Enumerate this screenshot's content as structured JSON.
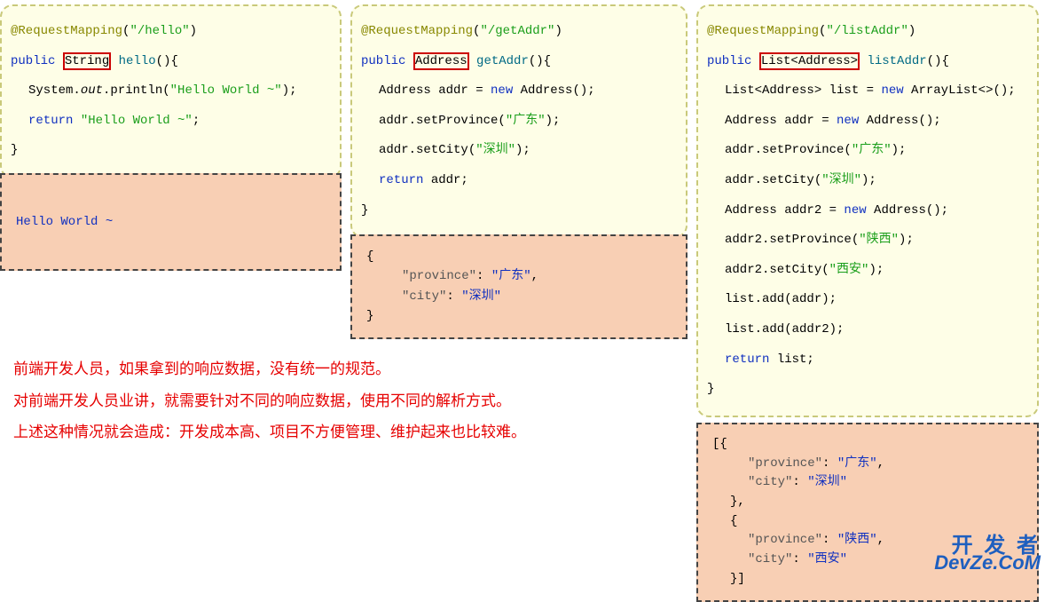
{
  "col1": {
    "anno": "@RequestMapping",
    "path": "\"/hello\"",
    "pub": "public",
    "type": "String",
    "method": "hello",
    "sys_pre": "System.",
    "sys_out": "out",
    "sys_post": ".println(",
    "sys_str": "\"Hello World ~\"",
    "ret": "return ",
    "ret_str": "\"Hello World ~\"",
    "output": "Hello World ~"
  },
  "col2": {
    "anno": "@RequestMapping",
    "path": "\"/getAddr\"",
    "pub": "public",
    "type": "Address",
    "method": "getAddr",
    "l1_pre": "Address addr = ",
    "l1_new": "new",
    "l1_post": " Address();",
    "l2_pre": "addr.setProvince(",
    "l2_str": "\"广东\"",
    "l3_pre": "addr.setCity(",
    "l3_str": "\"深圳\"",
    "ret": "return ",
    "ret_obj": "addr;",
    "out_k1": "\"province\"",
    "out_v1": "\"广东\"",
    "out_k2": "\"city\"",
    "out_v2": "\"深圳\""
  },
  "col3": {
    "anno": "@RequestMapping",
    "path": "\"/listAddr\"",
    "pub": "public",
    "type": "List<Address>",
    "method": "listAddr",
    "l1_pre": "List<Address> list = ",
    "l1_new": "new",
    "l1_post": " ArrayList<>();",
    "l2_pre": "Address addr = ",
    "l2_new": "new",
    "l2_post": " Address();",
    "l3_pre": "addr.setProvince(",
    "l3_str": "\"广东\"",
    "l4_pre": "addr.setCity(",
    "l4_str": "\"深圳\"",
    "l5_pre": "Address addr2 = ",
    "l5_new": "new",
    "l5_post": " Address();",
    "l6_pre": "addr2.setProvince(",
    "l6_str": "\"陕西\"",
    "l7_pre": "addr2.setCity(",
    "l7_str": "\"西安\"",
    "l8": "list.add(addr);",
    "l9": "list.add(addr2);",
    "ret": "return ",
    "ret_obj": "list;",
    "out_k1": "\"province\"",
    "out_v1": "\"广东\"",
    "out_k2": "\"city\"",
    "out_v2": "\"深圳\"",
    "out_k3": "\"province\"",
    "out_v3": "\"陕西\"",
    "out_k4": "\"city\"",
    "out_v4": "\"西安\""
  },
  "note": {
    "l1": "前端开发人员，如果拿到的响应数据，没有统一的规范。",
    "l2": "对前端开发人员业讲，就需要针对不同的响应数据，使用不同的解析方式。",
    "l3": "上述这种情况就会造成：开发成本高、项目不方便管理、维护起来也比较难。"
  },
  "watermark": {
    "l1": "开 发 者",
    "l2": "DevZe.CoM"
  }
}
